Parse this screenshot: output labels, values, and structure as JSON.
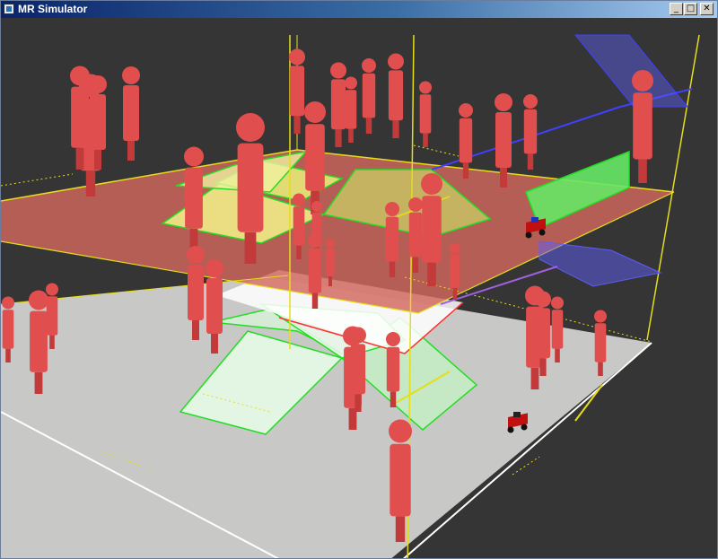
{
  "window": {
    "title": "MR Simulator",
    "controls": {
      "minimize": "_",
      "maximize": "□",
      "close": "✕"
    }
  },
  "colors": {
    "background": "#353535",
    "lower_floor": "#c8c8c6",
    "upper_floor": "#d2685e",
    "human_figure": "#e14e4e",
    "frame_lines": "#e6dd1a",
    "region_green": "#22dd22",
    "region_yellow": "#f4f48a",
    "sensor_blue": "#5d5df5"
  },
  "icons": {
    "app": "window-icon",
    "human": "human-figure-icon",
    "robot": "mobile-robot-icon"
  }
}
